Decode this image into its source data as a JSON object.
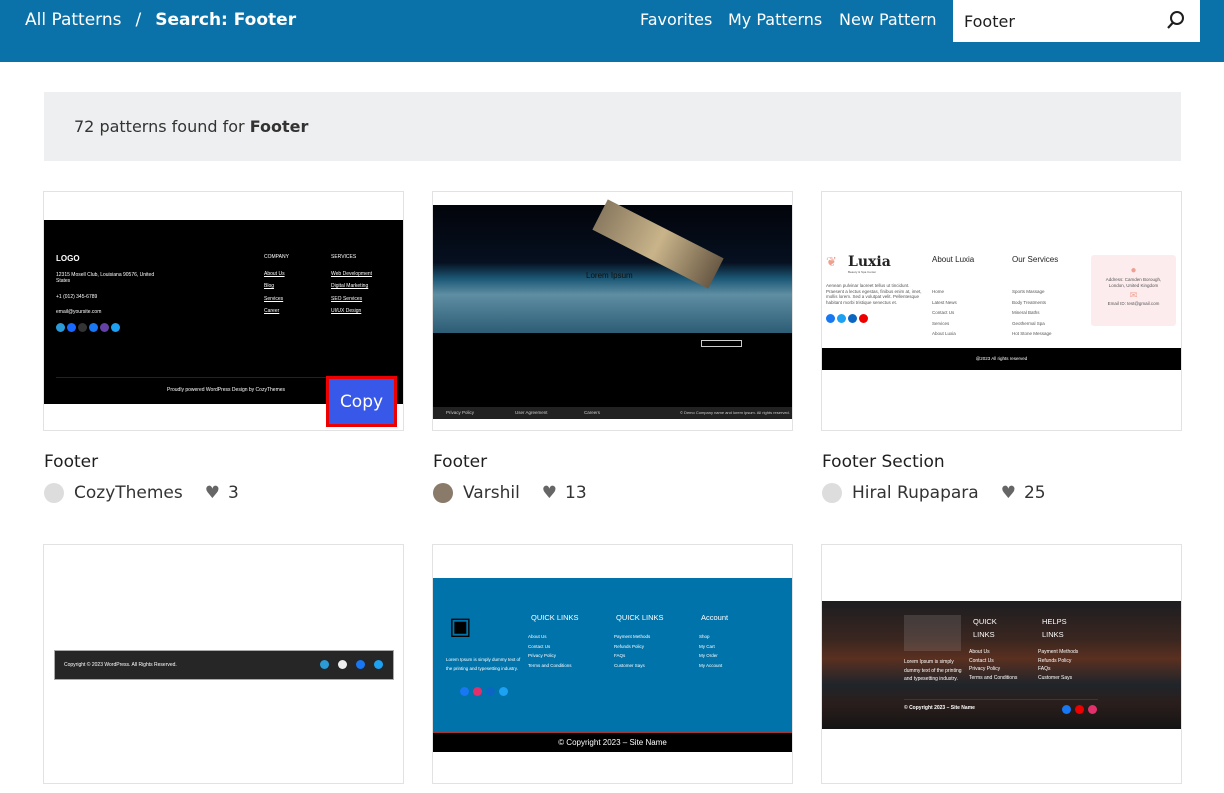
{
  "header": {
    "breadcrumb_root": "All Patterns",
    "breadcrumb_sep": "/",
    "breadcrumb_current": "Search: Footer",
    "nav": [
      "Favorites",
      "My Patterns",
      "New Pattern"
    ],
    "search_value": "Footer",
    "search_icon": "search-icon",
    "color": "#0a72a8"
  },
  "results": {
    "count_text": "72 patterns found for ",
    "query": "Footer"
  },
  "copy_label": "Copy",
  "cards": [
    {
      "title": "Footer",
      "author": "CozyThemes",
      "likes": "3",
      "preview": {
        "logo": "LOGO",
        "address": "12315 Mosell Club, Louisiana 90576, United States",
        "phone": "+1 (012) 345-6789",
        "email": "email@yoursite.com",
        "col1_title": "COMPANY",
        "col1": [
          "About Us",
          "Blog",
          "Services",
          "Career"
        ],
        "col2_title": "SERVICES",
        "col2": [
          "Web Development",
          "Digital Marketing",
          "SEO Services",
          "UI/UX Design"
        ],
        "bottom": "Proudly powered WordPress Design by CozyThemes"
      }
    },
    {
      "title": "Footer",
      "author": "Varshil",
      "likes": "13",
      "preview": {
        "hero_text": "Lorem Ipsum",
        "links": [
          "Privacy Policy",
          "User Agreement",
          "Careers"
        ],
        "copyright": "© Demo Company name and lorem ipsum. All rights reserved."
      }
    },
    {
      "title": "Footer Section",
      "author": "Hiral Rupapara",
      "likes": "25",
      "preview": {
        "brand": "Luxia",
        "tagline": "Beauty & Spa Center",
        "desc": "Aenean pulvinar laoreet tellus ut tincidunt. Praesent a lectus egestas, finibus enim at, imet, mollis lorem. Sed a volutpat velit. Pellentesque habitant morbi tristique senectus et.",
        "col1_title": "About Luxia",
        "col1": [
          "Home",
          "Latest News",
          "Contact Us",
          "Services",
          "About Luxia"
        ],
        "col2_title": "Our Services",
        "col2": [
          "Sports Massage",
          "Body Treatments",
          "Mineral Baths",
          "Geothermal Spa",
          "Hot Stone Message"
        ],
        "address": "Address: Camden Borough, London, United Kingdom",
        "email": "Email ID: test@gmail.com",
        "bottom": "@2023 All rights reserved"
      }
    },
    {
      "title": "",
      "author": "",
      "likes": "",
      "preview": {
        "copyright": "Copyright © 2023 WordPress. All Rights Reserved."
      }
    },
    {
      "title": "",
      "author": "",
      "likes": "",
      "preview": {
        "desc": "Lorem Ipsum is simply dummy text of the printing and typesetting industry.",
        "col1_title": "QUICK LINKS",
        "col1": [
          "About Us",
          "Contact Us",
          "Privacy Policy",
          "Terms and Conditions"
        ],
        "col2_title": "QUICK LINKS",
        "col2": [
          "Payment Methods",
          "Refunds Policy",
          "FAQs",
          "Customer Says"
        ],
        "col3_title": "Account",
        "col3": [
          "Shop",
          "My Cart",
          "My Order",
          "My Account"
        ],
        "bottom": "© Copyright 2023 – Site Name"
      }
    },
    {
      "title": "",
      "author": "",
      "likes": "",
      "preview": {
        "desc": "Lorem Ipsum is simply dummy text of the printing and typesetting industry.",
        "col1_title": "QUICK LINKS",
        "col1": [
          "About Us",
          "Contact Us",
          "Privacy Policy",
          "Terms and Conditions"
        ],
        "col2_title": "HELPS LINKS",
        "col2": [
          "Payment Methods",
          "Refunds Policy",
          "FAQs",
          "Customer Says"
        ],
        "bottom": "© Copyright 2023 – Site Name"
      }
    }
  ]
}
